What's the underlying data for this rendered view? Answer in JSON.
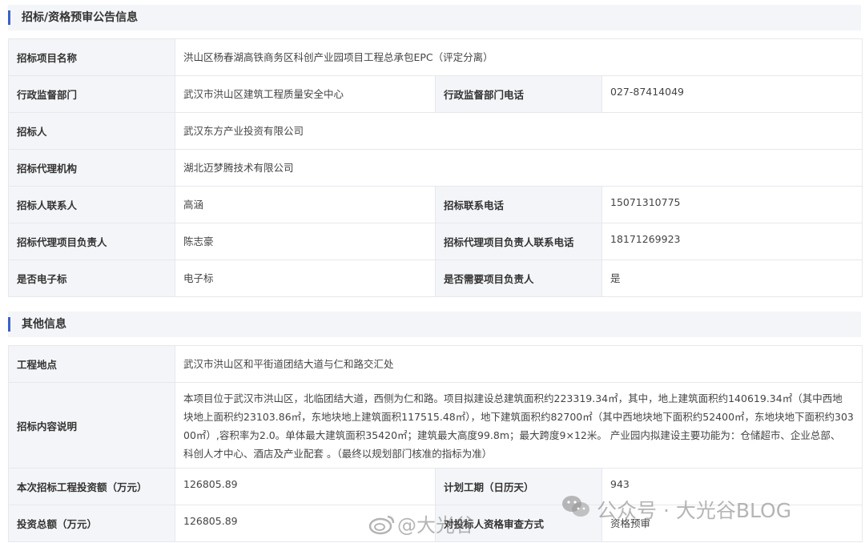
{
  "section1": {
    "title": "招标/资格预审公告信息",
    "rows": {
      "project_name_label": "招标项目名称",
      "project_name": "洪山区杨春湖高铁商务区科创产业园项目工程总承包EPC（评定分离）",
      "supervisor_label": "行政监督部门",
      "supervisor": "武汉市洪山区建筑工程质量安全中心",
      "supervisor_phone_label": "行政监督部门电话",
      "supervisor_phone": "027-87414049",
      "tenderer_label": "招标人",
      "tenderer": "武汉东方产业投资有限公司",
      "agency_label": "招标代理机构",
      "agency": "湖北迈梦腾技术有限公司",
      "contact_label": "招标人联系人",
      "contact": "高涵",
      "contact_phone_label": "招标联系电话",
      "contact_phone": "15071310775",
      "agent_lead_label": "招标代理项目负责人",
      "agent_lead": "陈志豪",
      "agent_lead_phone_label": "招标代理项目负责人联系电话",
      "agent_lead_phone": "18171269923",
      "electronic_label": "是否电子标",
      "electronic": "电子标",
      "need_pm_label": "是否需要项目负责人",
      "need_pm": "是"
    }
  },
  "section2": {
    "title": "其他信息",
    "rows": {
      "location_label": "工程地点",
      "location": "武汉市洪山区和平街道团结大道与仁和路交汇处",
      "content_label": "招标内容说明",
      "content_lines": [
        "本项目位于武汉市洪山区，北临团结大道，西侧为仁和路。项目拟建设总建筑面积约223319.34㎡，其中，地上建筑面积约140619.34㎡（其中西地",
        "块地上面积约23103.86㎡，东地块地上建筑面积117515.48㎡），地下建筑面积约82700㎡（其中西地块地下面积约52400㎡，东地块地下面积约303",
        "00㎡）,容积率为2.0。单体最大建筑面积35420㎡；建筑最大高度99.8m；最大跨度9×12米。 产业园内拟建设主要功能为：仓储超市、企业总部、",
        "科创人才中心、酒店及产业配套 。（最终以规划部门核准的指标为准）"
      ],
      "invest_label": "本次招标工程投资额（万元）",
      "invest": "126805.89",
      "duration_label": "计划工期（日历天）",
      "duration": "943",
      "total_label": "投资总额（万元）",
      "total": "126805.89",
      "review_label": "对投标人资格审查方式",
      "review": "资格预审"
    }
  },
  "watermark": {
    "wechat": "公众号 · 大光谷BLOG",
    "weibo": "@大光谷"
  }
}
